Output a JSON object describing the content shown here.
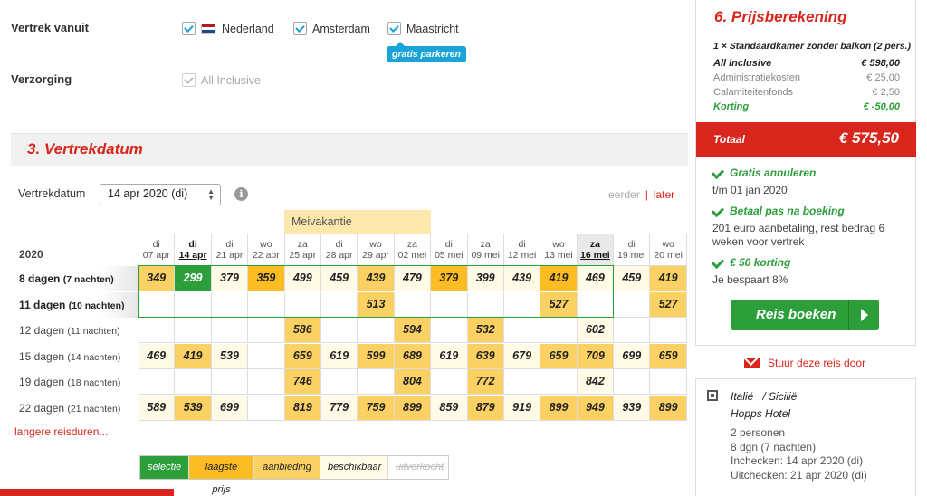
{
  "options": {
    "vertrek_label": "Vertrek vanuit",
    "vertrek_items": [
      {
        "label": "Nederland",
        "checked": true
      },
      {
        "label": "Amsterdam",
        "checked": true
      },
      {
        "label": "Maastricht",
        "checked": true
      }
    ],
    "parking_badge": "gratis parkeren",
    "verzorging_label": "Verzorging",
    "verzorging_item": "All Inclusive"
  },
  "section": {
    "title": "3. Vertrekdatum",
    "date_label": "Vertrekdatum",
    "date_value": "14 apr 2020 (di)",
    "info": "i",
    "earlier": "eerder",
    "sep": "|",
    "later": "later",
    "holiday": "Meivakantie",
    "year": "2020",
    "more": "langere reisduren...",
    "columns": [
      {
        "day": "di",
        "date": "07 apr"
      },
      {
        "day": "di",
        "date": "14 apr"
      },
      {
        "day": "di",
        "date": "21 apr"
      },
      {
        "day": "wo",
        "date": "22 apr"
      },
      {
        "day": "za",
        "date": "25 apr"
      },
      {
        "day": "di",
        "date": "28 apr"
      },
      {
        "day": "wo",
        "date": "29 apr"
      },
      {
        "day": "za",
        "date": "02 mei"
      },
      {
        "day": "di",
        "date": "05 mei"
      },
      {
        "day": "za",
        "date": "09 mei"
      },
      {
        "day": "di",
        "date": "12 mei"
      },
      {
        "day": "wo",
        "date": "13 mei"
      },
      {
        "day": "za",
        "date": "16 mei"
      },
      {
        "day": "di",
        "date": "19 mei"
      },
      {
        "day": "wo",
        "date": "20 mei"
      }
    ],
    "rows": [
      {
        "days": "8 dagen",
        "nights": "(7 nachten)",
        "bold": true,
        "cells": [
          [
            "349",
            "y"
          ],
          [
            "299",
            "g"
          ],
          [
            "379",
            "w"
          ],
          [
            "359",
            "o"
          ],
          [
            "499",
            "w"
          ],
          [
            "459",
            "w"
          ],
          [
            "439",
            "y"
          ],
          [
            "479",
            "w"
          ],
          [
            "379",
            "o"
          ],
          [
            "399",
            "w"
          ],
          [
            "439",
            "w"
          ],
          [
            "419",
            "o"
          ],
          [
            "469",
            "w"
          ],
          [
            "459",
            "w"
          ],
          [
            "419",
            "y"
          ]
        ]
      },
      {
        "days": "11 dagen",
        "nights": "(10 nachten)",
        "bold": true,
        "cells": [
          [
            "",
            ""
          ],
          [
            "",
            ""
          ],
          [
            "",
            ""
          ],
          [
            "",
            ""
          ],
          [
            "",
            ""
          ],
          [
            "",
            ""
          ],
          [
            "513",
            "y"
          ],
          [
            "",
            ""
          ],
          [
            "",
            ""
          ],
          [
            "",
            ""
          ],
          [
            "",
            ""
          ],
          [
            "527",
            "y"
          ],
          [
            "",
            ""
          ],
          [
            "",
            ""
          ],
          [
            "527",
            "y"
          ]
        ]
      },
      {
        "days": "12 dagen",
        "nights": "(11 nachten)",
        "bold": false,
        "cells": [
          [
            "",
            ""
          ],
          [
            "",
            ""
          ],
          [
            "",
            ""
          ],
          [
            "",
            ""
          ],
          [
            "586",
            "y"
          ],
          [
            "",
            ""
          ],
          [
            "",
            ""
          ],
          [
            "594",
            "y"
          ],
          [
            "",
            ""
          ],
          [
            "532",
            "y"
          ],
          [
            "",
            ""
          ],
          [
            "",
            ""
          ],
          [
            "602",
            "w"
          ],
          [
            "",
            ""
          ],
          [
            "",
            ""
          ]
        ]
      },
      {
        "days": "15 dagen",
        "nights": "(14 nachten)",
        "bold": false,
        "cells": [
          [
            "469",
            "w"
          ],
          [
            "419",
            "y"
          ],
          [
            "539",
            "w"
          ],
          [
            "",
            ""
          ],
          [
            "659",
            "y"
          ],
          [
            "619",
            "w"
          ],
          [
            "599",
            "y"
          ],
          [
            "689",
            "y"
          ],
          [
            "619",
            "w"
          ],
          [
            "639",
            "y"
          ],
          [
            "679",
            "w"
          ],
          [
            "659",
            "y"
          ],
          [
            "709",
            "y"
          ],
          [
            "699",
            "w"
          ],
          [
            "659",
            "y"
          ]
        ]
      },
      {
        "days": "19 dagen",
        "nights": "(18 nachten)",
        "bold": false,
        "cells": [
          [
            "",
            ""
          ],
          [
            "",
            ""
          ],
          [
            "",
            ""
          ],
          [
            "",
            ""
          ],
          [
            "746",
            "y"
          ],
          [
            "",
            ""
          ],
          [
            "",
            ""
          ],
          [
            "804",
            "y"
          ],
          [
            "",
            ""
          ],
          [
            "772",
            "y"
          ],
          [
            "",
            ""
          ],
          [
            "",
            ""
          ],
          [
            "842",
            "w"
          ],
          [
            "",
            ""
          ],
          [
            "",
            ""
          ]
        ]
      },
      {
        "days": "22 dagen",
        "nights": "(21 nachten)",
        "bold": false,
        "cells": [
          [
            "589",
            "w"
          ],
          [
            "539",
            "y"
          ],
          [
            "699",
            "w"
          ],
          [
            "",
            ""
          ],
          [
            "819",
            "y"
          ],
          [
            "779",
            "w"
          ],
          [
            "759",
            "y"
          ],
          [
            "899",
            "y"
          ],
          [
            "859",
            "w"
          ],
          [
            "879",
            "y"
          ],
          [
            "919",
            "w"
          ],
          [
            "899",
            "y"
          ],
          [
            "949",
            "y"
          ],
          [
            "939",
            "w"
          ],
          [
            "899",
            "y"
          ]
        ]
      }
    ],
    "legend": {
      "selectie": "selectie",
      "laagste": "laagste prijs",
      "aanbieding": "aanbieding",
      "beschikbaar": "beschikbaar",
      "uitverkocht": "uitverkocht"
    }
  },
  "price": {
    "title": "6. Prijsberekening",
    "room": "1 × Standaardkamer zonder balkon (2 pers.)",
    "lines": [
      {
        "label": "All Inclusive",
        "value": "€ 598,00",
        "kind": "main"
      },
      {
        "label": "Administratiekosten",
        "value": "€ 25,00",
        "kind": "muted"
      },
      {
        "label": "Calamiteitenfonds",
        "value": "€ 2,50",
        "kind": "muted"
      },
      {
        "label": "Korting",
        "value": "€ -50,00",
        "kind": "green"
      }
    ],
    "total_label": "Totaal",
    "total_value": "€ 575,50",
    "features": [
      {
        "title": "Gratis annuleren",
        "text": "t/m 01 jan 2020"
      },
      {
        "title": "Betaal pas na boeking",
        "text": "201 euro aanbetaling, rest bedrag 6 weken voor vertrek"
      },
      {
        "title": "€ 50 korting",
        "text": "Je bespaart 8%"
      }
    ],
    "book_button": "Reis boeken",
    "mail_link": "Stuur deze reis door"
  },
  "hotel": {
    "country": "Italië",
    "region": "/ Sicilië",
    "name": "Hopps Hotel",
    "persons": "2 personen",
    "duration": "8 dgn (7 nachten)",
    "checkin": "Inchecken: 14 apr 2020 (di)",
    "checkout": "Uitchecken: 21 apr 2020 (di)"
  },
  "colors": {
    "accent": "#d9261c",
    "green": "#2c9e3a",
    "blue": "#1aa3d9"
  }
}
